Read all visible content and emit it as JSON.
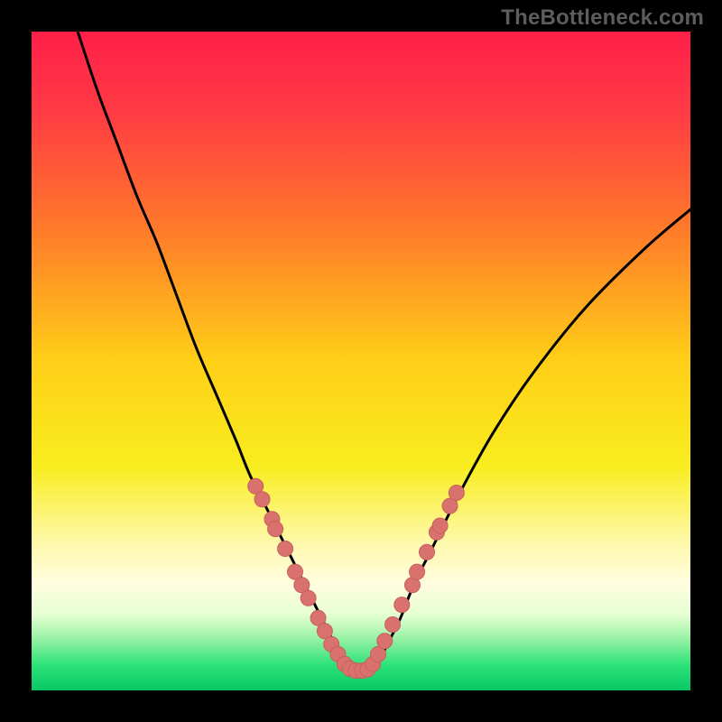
{
  "watermark": "TheBottleneck.com",
  "colors": {
    "frame": "#000000",
    "curve": "#000000",
    "marker_fill": "#d9726e",
    "marker_stroke": "#c95f5b",
    "gradient_stops": [
      {
        "offset": 0.0,
        "color": "#ff1f49"
      },
      {
        "offset": 0.12,
        "color": "#ff3a44"
      },
      {
        "offset": 0.3,
        "color": "#ff7a2a"
      },
      {
        "offset": 0.5,
        "color": "#ffcf17"
      },
      {
        "offset": 0.66,
        "color": "#f8ed1f"
      },
      {
        "offset": 0.78,
        "color": "#fff9b0"
      },
      {
        "offset": 0.84,
        "color": "#fffde0"
      },
      {
        "offset": 0.885,
        "color": "#e6ffd2"
      },
      {
        "offset": 0.92,
        "color": "#9cf2a7"
      },
      {
        "offset": 0.96,
        "color": "#2fe37a"
      },
      {
        "offset": 1.0,
        "color": "#07c765"
      }
    ]
  },
  "chart_data": {
    "type": "line",
    "title": "",
    "xlabel": "",
    "ylabel": "",
    "xlim": [
      0,
      100
    ],
    "ylim": [
      0,
      100
    ],
    "series": [
      {
        "name": "bottleneck-curve",
        "x": [
          7,
          10,
          13,
          16,
          19,
          22,
          25,
          28,
          31,
          33,
          35,
          37,
          39,
          41,
          43,
          45,
          46,
          47,
          48,
          49,
          51,
          52,
          53,
          54,
          56,
          58,
          61,
          65,
          70,
          76,
          84,
          93,
          100
        ],
        "y": [
          100,
          91,
          83,
          75,
          68,
          60,
          52,
          45,
          38,
          33,
          29,
          25,
          21,
          17,
          13,
          9,
          7,
          5,
          3.5,
          3,
          3,
          3.5,
          5,
          7,
          11,
          16,
          22,
          30,
          39,
          48,
          58,
          67,
          73
        ]
      }
    ],
    "markers": {
      "name": "highlight-points",
      "points": [
        {
          "x": 34,
          "y": 31
        },
        {
          "x": 35,
          "y": 29
        },
        {
          "x": 36.5,
          "y": 26
        },
        {
          "x": 37,
          "y": 24.5
        },
        {
          "x": 38.5,
          "y": 21.5
        },
        {
          "x": 40,
          "y": 18
        },
        {
          "x": 41,
          "y": 16
        },
        {
          "x": 42,
          "y": 14
        },
        {
          "x": 43.5,
          "y": 11
        },
        {
          "x": 44.5,
          "y": 9
        },
        {
          "x": 45.5,
          "y": 7
        },
        {
          "x": 46.5,
          "y": 5.5
        },
        {
          "x": 47.5,
          "y": 4
        },
        {
          "x": 48.3,
          "y": 3.3
        },
        {
          "x": 49.2,
          "y": 3.0
        },
        {
          "x": 50.2,
          "y": 3.0
        },
        {
          "x": 51.0,
          "y": 3.2
        },
        {
          "x": 51.8,
          "y": 4.0
        },
        {
          "x": 52.6,
          "y": 5.5
        },
        {
          "x": 53.6,
          "y": 7.5
        },
        {
          "x": 54.8,
          "y": 10
        },
        {
          "x": 56.2,
          "y": 13
        },
        {
          "x": 57.8,
          "y": 16
        },
        {
          "x": 58.5,
          "y": 18
        },
        {
          "x": 60,
          "y": 21
        },
        {
          "x": 61.5,
          "y": 24
        },
        {
          "x": 62,
          "y": 25
        },
        {
          "x": 63.5,
          "y": 28
        },
        {
          "x": 64.5,
          "y": 30
        }
      ]
    }
  }
}
